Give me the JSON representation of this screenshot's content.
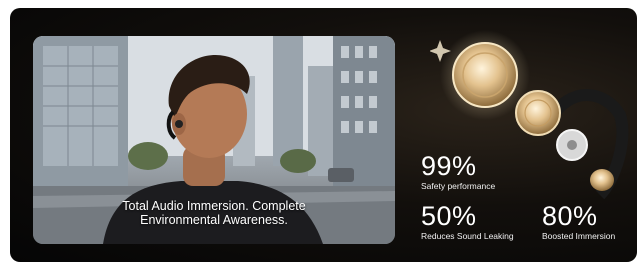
{
  "caption": {
    "line1": "Total Audio Immersion. Complete",
    "line2": "Environmental Awareness."
  },
  "stats": [
    {
      "value": "99%",
      "label": "Safety performance"
    },
    {
      "value": "50%",
      "label": "Reduces Sound Leaking"
    },
    {
      "value": "80%",
      "label": "Boosted Immersion"
    }
  ],
  "colors": {
    "background": "#0b0907",
    "gold": "#d9b47a",
    "text": "#ffffff"
  }
}
